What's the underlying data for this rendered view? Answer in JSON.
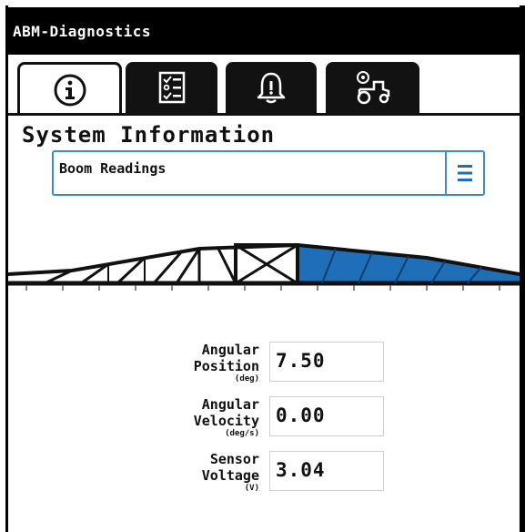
{
  "window": {
    "title": "ABM-Diagnostics"
  },
  "tabs": [
    {
      "icon": "info-icon",
      "active": true
    },
    {
      "icon": "checklist-icon",
      "active": false
    },
    {
      "icon": "bell-icon",
      "active": false
    },
    {
      "icon": "tractor-settings-icon",
      "active": false
    }
  ],
  "page": {
    "title": "System Information"
  },
  "selector": {
    "value": "Boom Readings",
    "icon": "menu-icon"
  },
  "boom": {
    "icon": "boom-diagram",
    "highlight_color": "#1f6fb8"
  },
  "readings": [
    {
      "label_line1": "Angular",
      "label_line2": "Position",
      "unit": "(deg)",
      "value": "7.50"
    },
    {
      "label_line1": "Angular",
      "label_line2": "Velocity",
      "unit": "(deg/s)",
      "value": "0.00"
    },
    {
      "label_line1": "Sensor",
      "label_line2": "Voltage",
      "unit": "(V)",
      "value": "3.04"
    }
  ]
}
